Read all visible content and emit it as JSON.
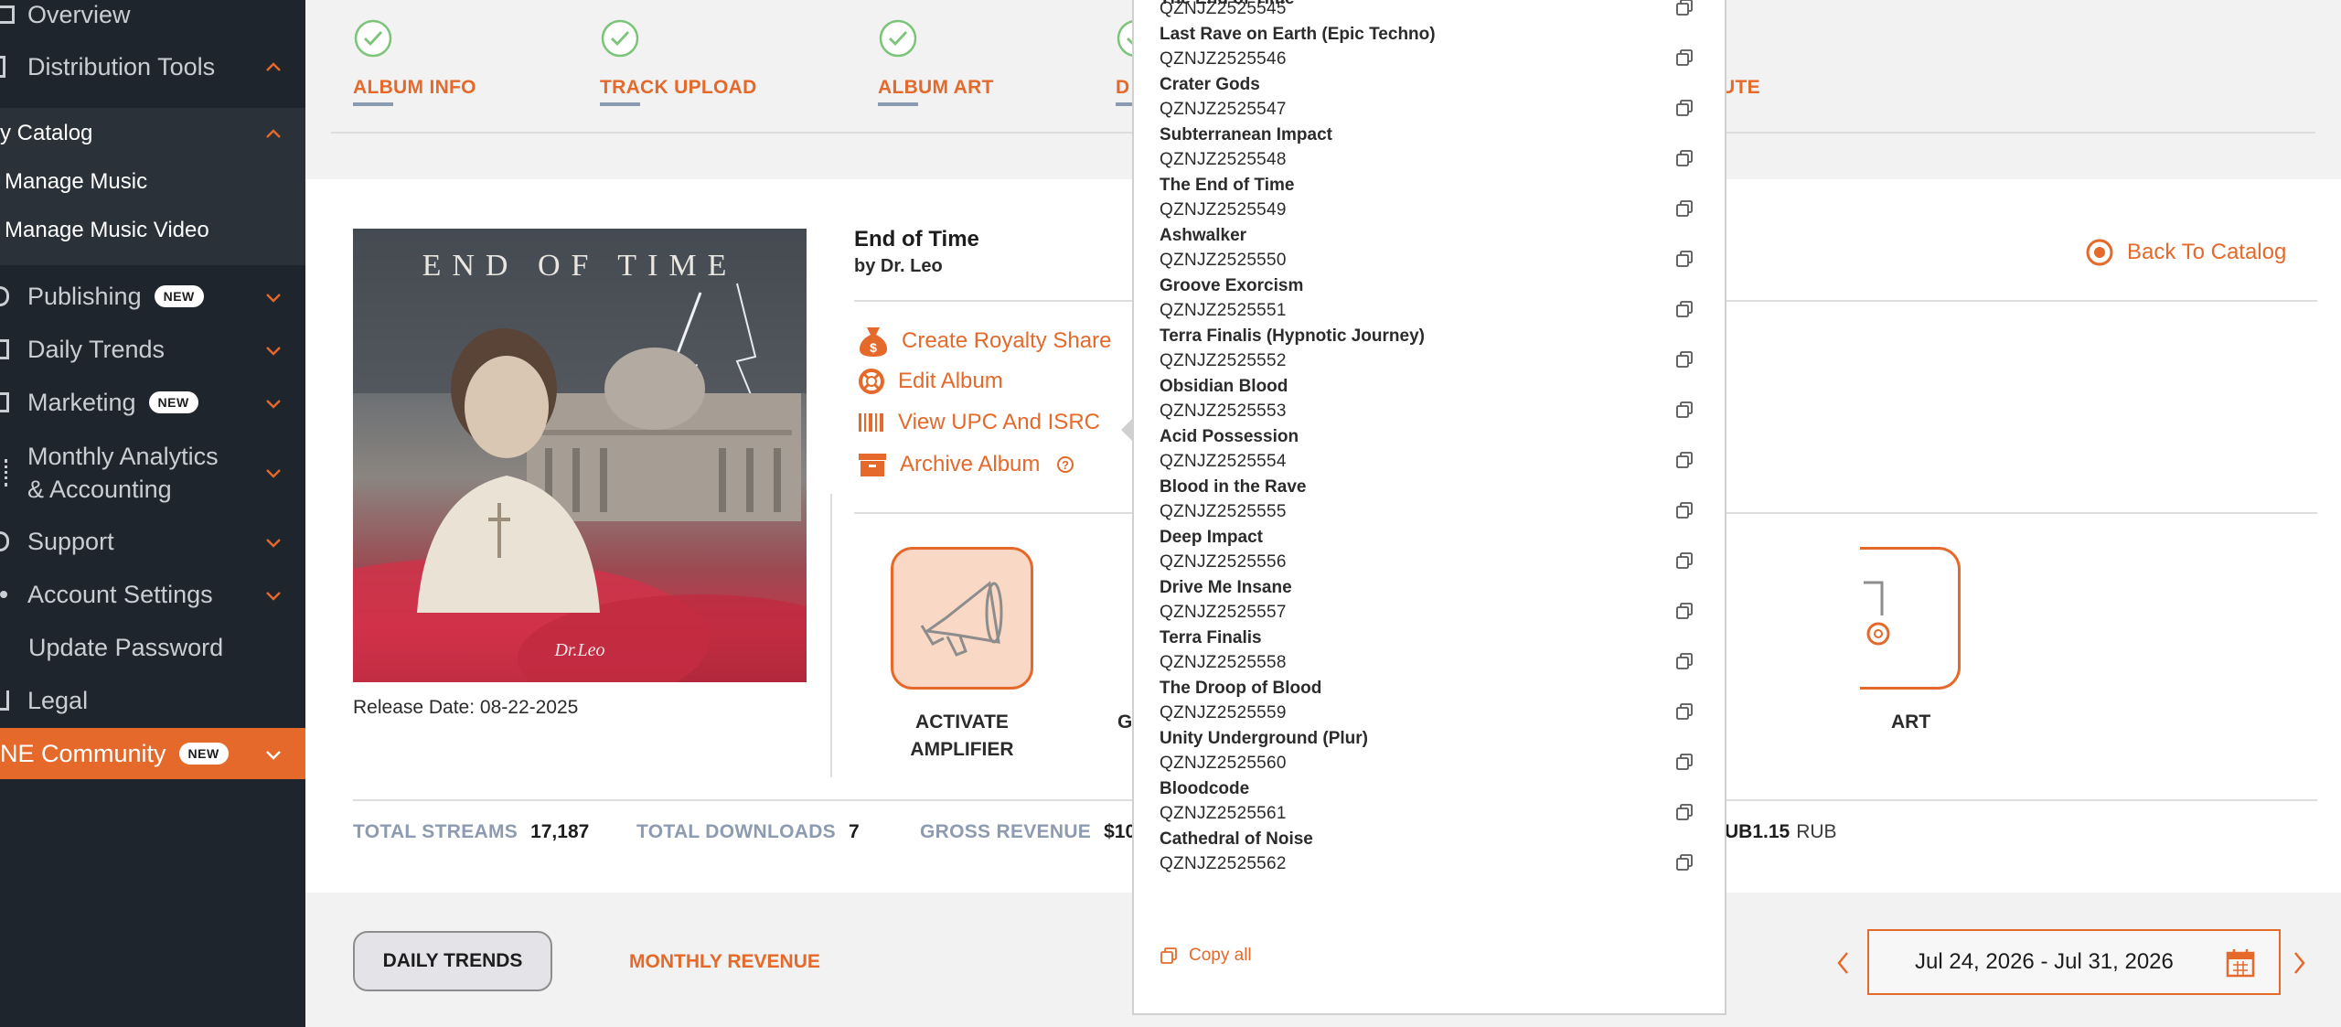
{
  "sidebar": {
    "items": [
      {
        "label": "Overview"
      },
      {
        "label": "Distribution Tools"
      },
      {
        "label": "y Catalog"
      },
      {
        "label": "Manage Music"
      },
      {
        "label": "Manage Music Video"
      },
      {
        "label": "Publishing",
        "badge": "NEW"
      },
      {
        "label": "Daily Trends"
      },
      {
        "label": "Marketing",
        "badge": "NEW"
      },
      {
        "label": "Monthly Analytics"
      },
      {
        "label": "& Accounting"
      },
      {
        "label": "Support"
      },
      {
        "label": "Account Settings"
      },
      {
        "label": "Update Password"
      },
      {
        "label": "Legal"
      },
      {
        "label": "NE Community",
        "badge": "NEW"
      }
    ]
  },
  "steps": [
    {
      "label": "ALBUM INFO"
    },
    {
      "label": "TRACK UPLOAD"
    },
    {
      "label": "ALBUM ART"
    },
    {
      "label": "D"
    },
    {
      "label": "UTE"
    }
  ],
  "album": {
    "art_text": "END OF TIME",
    "art_logo": "Dr.Leo",
    "title": "End of Time",
    "artist": "by Dr. Leo",
    "release_date": "Release Date: 08-22-2025",
    "back_link": "Back To Catalog",
    "actions": {
      "royalty": "Create Royalty Share",
      "edit": "Edit Album",
      "upc": "View UPC And ISRC",
      "archive": "Archive Album"
    },
    "tiles": {
      "amplifier_line1": "ACTIVATE",
      "amplifier_line2": "AMPLIFIER",
      "partial_left": "G",
      "partial_right": "ART"
    }
  },
  "stats": {
    "streams_label": "TOTAL STREAMS",
    "streams_value": "17,187",
    "downloads_label": "TOTAL DOWNLOADS",
    "downloads_value": "7",
    "revenue_label": "GROSS REVENUE",
    "revenue_value": "$10",
    "rub_value": "UB1.15",
    "rub_unit": "RUB"
  },
  "isrc_popup": {
    "top_partial_title": "The End of Time",
    "rows": [
      {
        "title": "",
        "code": "QZNJZ2525545"
      },
      {
        "title": "Last Rave on Earth (Epic Techno)",
        "code": "QZNJZ2525546"
      },
      {
        "title": "Crater Gods",
        "code": "QZNJZ2525547"
      },
      {
        "title": "Subterranean Impact",
        "code": "QZNJZ2525548"
      },
      {
        "title": "The End of Time",
        "code": "QZNJZ2525549"
      },
      {
        "title": "Ashwalker",
        "code": "QZNJZ2525550"
      },
      {
        "title": "Groove Exorcism",
        "code": "QZNJZ2525551"
      },
      {
        "title": "Terra Finalis (Hypnotic Journey)",
        "code": "QZNJZ2525552"
      },
      {
        "title": "Obsidian Blood",
        "code": "QZNJZ2525553"
      },
      {
        "title": "Acid Possession",
        "code": "QZNJZ2525554"
      },
      {
        "title": "Blood in the Rave",
        "code": "QZNJZ2525555"
      },
      {
        "title": "Deep Impact",
        "code": "QZNJZ2525556"
      },
      {
        "title": "Drive Me Insane",
        "code": "QZNJZ2525557"
      },
      {
        "title": "Terra Finalis",
        "code": "QZNJZ2525558"
      },
      {
        "title": "The Droop of Blood",
        "code": "QZNJZ2525559"
      },
      {
        "title": "Unity Underground (Plur)",
        "code": "QZNJZ2525560"
      },
      {
        "title": "Bloodcode",
        "code": "QZNJZ2525561"
      },
      {
        "title": "Cathedral of Noise",
        "code": "QZNJZ2525562"
      }
    ],
    "copy_all": "Copy all"
  },
  "bottom": {
    "daily_trends": "DAILY TRENDS",
    "monthly_revenue": "MONTHLY REVENUE",
    "date_range": "Jul 24, 2026 - Jul 31, 2026"
  },
  "colors": {
    "accent": "#e4692b",
    "sidebar_bg": "#1f252c",
    "check_green": "#7cc47a"
  }
}
